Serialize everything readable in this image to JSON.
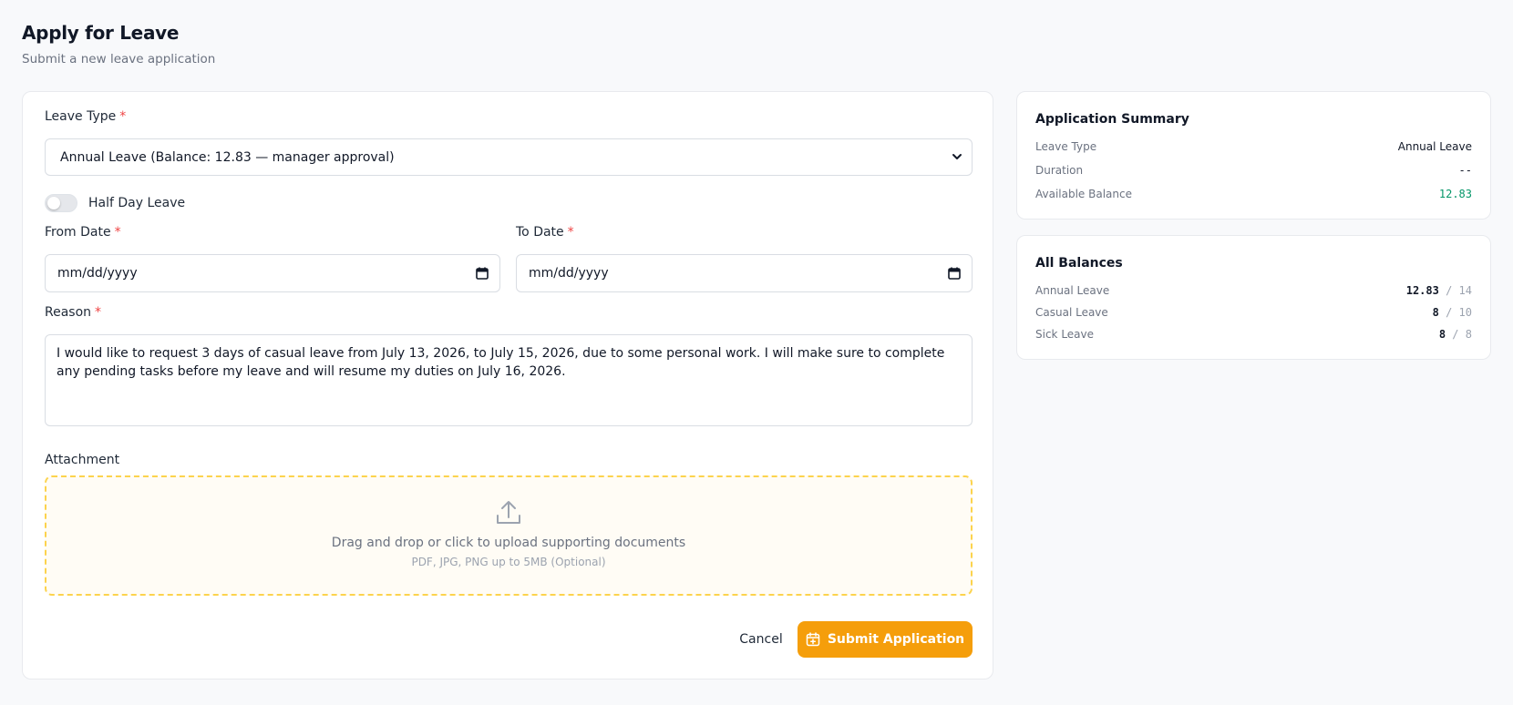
{
  "page": {
    "title": "Apply for Leave",
    "subtitle": "Submit a new leave application"
  },
  "form": {
    "leave_type": {
      "label": "Leave Type",
      "required_mark": "*",
      "selected": "Annual Leave (Balance: 12.83 — manager approval)"
    },
    "half_day": {
      "label": "Half Day Leave",
      "enabled": false
    },
    "from_date": {
      "label": "From Date",
      "required_mark": "*",
      "placeholder": "mm/dd/yyyy"
    },
    "to_date": {
      "label": "To Date",
      "required_mark": "*",
      "placeholder": "mm/dd/yyyy"
    },
    "reason": {
      "label": "Reason",
      "required_mark": "*",
      "value": "I would like to request 3 days of casual leave from July 13, 2026, to July 15, 2026, due to some personal work. I will make sure to complete any pending tasks before my leave and will resume my duties on July 16, 2026."
    },
    "attachment": {
      "label": "Attachment",
      "drop_text": "Drag and drop or click to upload supporting documents",
      "hint": "PDF, JPG, PNG up to 5MB (Optional)"
    },
    "actions": {
      "cancel": "Cancel",
      "submit": "Submit Application"
    }
  },
  "summary": {
    "title": "Application Summary",
    "rows": [
      {
        "label": "Leave Type",
        "value": "Annual Leave"
      },
      {
        "label": "Duration",
        "value": "--"
      },
      {
        "label": "Available Balance",
        "value": "12.83"
      }
    ]
  },
  "balances": {
    "title": "All Balances",
    "separator": "/",
    "rows": [
      {
        "label": "Annual Leave",
        "used": "12.83",
        "total": "14"
      },
      {
        "label": "Casual Leave",
        "used": "8",
        "total": "10"
      },
      {
        "label": "Sick Leave",
        "used": "8",
        "total": "8"
      }
    ]
  },
  "colors": {
    "accent": "#f59e0b",
    "required": "#ef4444",
    "balance_green": "#059669",
    "dropzone_border": "#fcd34d"
  },
  "icons": {
    "select": "chevron-down-icon",
    "date": "calendar-icon",
    "upload": "upload-icon",
    "submit": "calendar-plus-icon"
  }
}
